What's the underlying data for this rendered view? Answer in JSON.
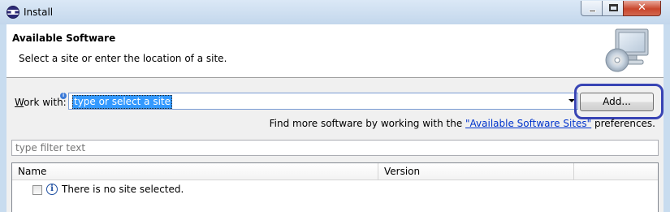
{
  "window": {
    "title": "Install",
    "minimize_icon": "minimize-icon",
    "maximize_icon": "maximize-icon",
    "close_icon": "close-icon",
    "close_glyph": "✕"
  },
  "header": {
    "title": "Available Software",
    "description": "Select a site or enter the location of a site.",
    "image_icon": "install-wizard-computer-icon"
  },
  "work_with": {
    "label_mnemonic": "W",
    "label_rest": "ork with:",
    "info_marker": "i",
    "combo_value": "type or select a site",
    "add_button_label": "Add...",
    "find_more_prefix": "Find more software by working with the ",
    "find_more_link": "\"Available Software Sites\"",
    "find_more_suffix": " preferences."
  },
  "filter": {
    "placeholder": "type filter text"
  },
  "table": {
    "columns": [
      "Name",
      "Version",
      ""
    ],
    "rows": [
      {
        "checked": false,
        "icon": "info-icon",
        "icon_glyph": "i",
        "text": "There is no site selected."
      }
    ]
  },
  "colors": {
    "selection": "#3399ff",
    "link": "#0033cc",
    "highlight_ring": "#3844b4"
  }
}
